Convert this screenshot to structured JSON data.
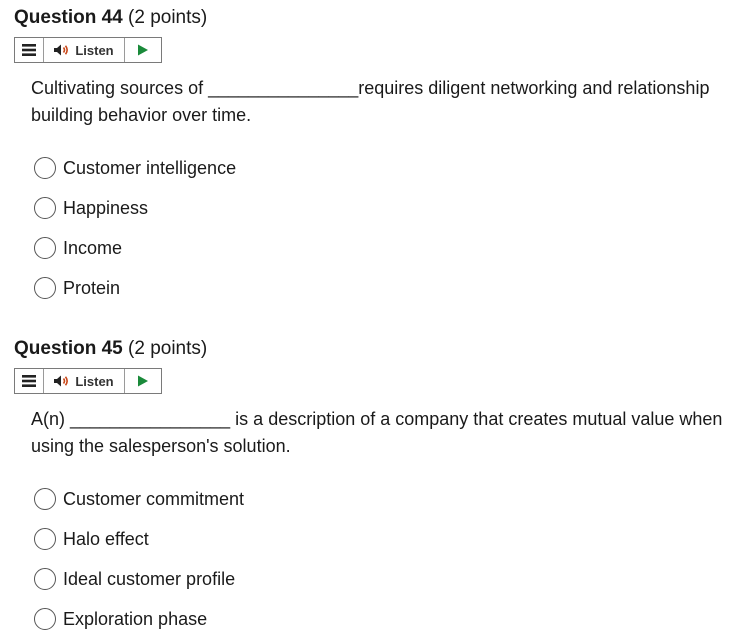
{
  "questions": [
    {
      "title": "Question 44",
      "points": "(2 points)",
      "listen_label": "Listen",
      "text": "Cultivating sources of _______________requires diligent networking and relationship building behavior over time.",
      "options": [
        "Customer intelligence",
        "Happiness",
        "Income",
        "Protein"
      ]
    },
    {
      "title": "Question 45",
      "points": "(2 points)",
      "listen_label": "Listen",
      "text": "A(n) ________________ is a description of a company that creates mutual value when using the salesperson's solution.",
      "options": [
        "Customer commitment",
        "Halo effect",
        "Ideal customer profile",
        "Exploration phase"
      ]
    }
  ],
  "icons": {
    "menu": "menu-icon",
    "speaker": "speaker-icon",
    "play": "play-icon",
    "play_color": "#1a8a3a"
  }
}
